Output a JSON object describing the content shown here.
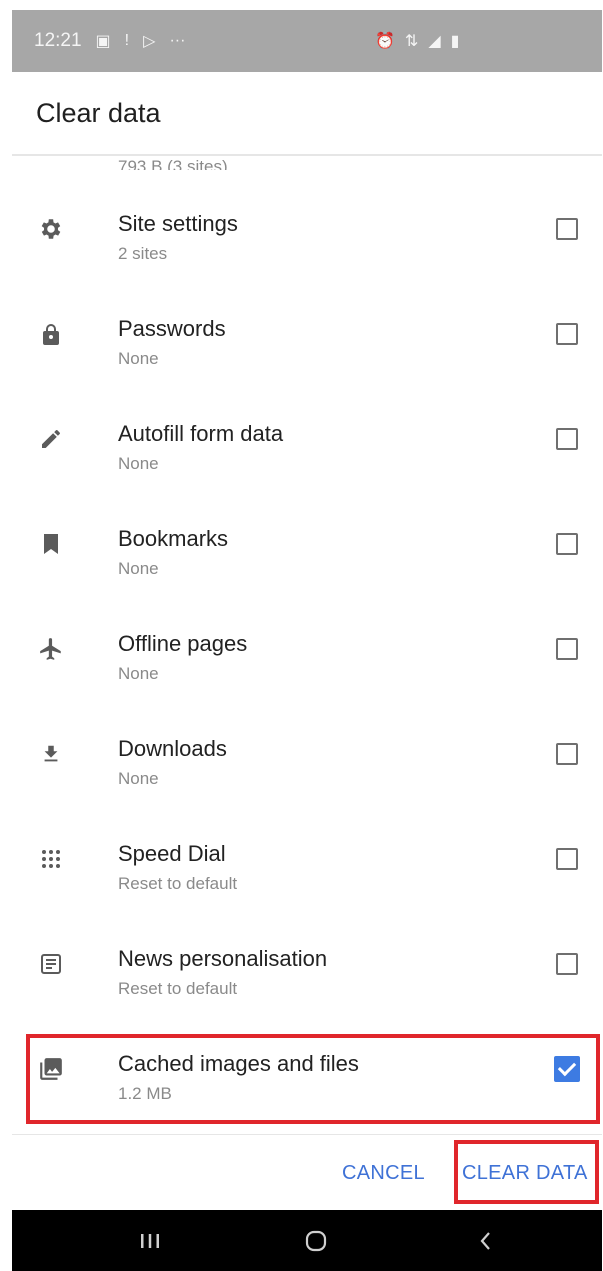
{
  "status_bar": {
    "time": "12:21",
    "left_icons": [
      "image-icon",
      "alert-icon",
      "play-icon",
      "more-icon"
    ],
    "right_icons": [
      "alarm-icon",
      "data-icon",
      "signal-icon",
      "battery-icon"
    ]
  },
  "header": {
    "title": "Clear data"
  },
  "cut_off_row": {
    "sub": "793 B (3 sites)"
  },
  "items": [
    {
      "label": "Site settings",
      "sub": "2 sites",
      "icon": "gear-icon",
      "checked": false
    },
    {
      "label": "Passwords",
      "sub": "None",
      "icon": "lock-icon",
      "checked": false
    },
    {
      "label": "Autofill form data",
      "sub": "None",
      "icon": "pencil-icon",
      "checked": false
    },
    {
      "label": "Bookmarks",
      "sub": "None",
      "icon": "bookmark-icon",
      "checked": false
    },
    {
      "label": "Offline pages",
      "sub": "None",
      "icon": "airplane-icon",
      "checked": false
    },
    {
      "label": "Downloads",
      "sub": "None",
      "icon": "download-icon",
      "checked": false
    },
    {
      "label": "Speed Dial",
      "sub": "Reset to default",
      "icon": "grid-dots-icon",
      "checked": false
    },
    {
      "label": "News personalisation",
      "sub": "Reset to default",
      "icon": "news-icon",
      "checked": false
    },
    {
      "label": "Cached images and files",
      "sub": "1.2 MB",
      "icon": "images-icon",
      "checked": true
    }
  ],
  "footer": {
    "cancel_label": "CANCEL",
    "clear_label": "CLEAR DATA"
  },
  "colors": {
    "accent": "#3f72d6",
    "checkbox_checked": "#3d7be2",
    "highlight": "#e0262b"
  }
}
